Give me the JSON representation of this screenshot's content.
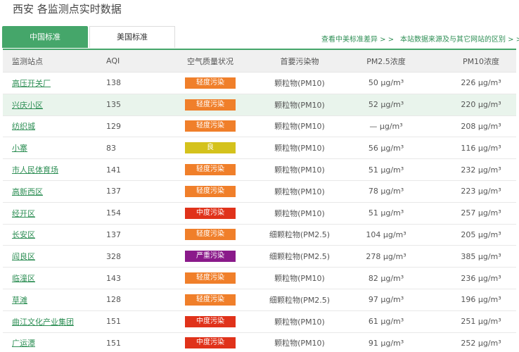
{
  "page": {
    "title": "西安 各监测点实时数据"
  },
  "tabs": [
    {
      "label": "中国标准",
      "active": true
    },
    {
      "label": "美国标准",
      "active": false
    }
  ],
  "links": {
    "standard_diff": "查看中美标准差异 > >",
    "source_diff": "本站数据来源及与其它网站的区别 > >"
  },
  "colors": {
    "accent": "#45a66a",
    "level_good": "#d4c21c",
    "level_light": "#f07f2a",
    "level_medium": "#e0321a",
    "level_severe": "#8a1a8a"
  },
  "table": {
    "headers": [
      "监测站点",
      "AQI",
      "空气质量状况",
      "首要污染物",
      "PM2.5浓度",
      "PM10浓度"
    ],
    "rows": [
      {
        "site": "高压开关厂",
        "aqi": "138",
        "level": "轻度污染",
        "level_color": "#f07f2a",
        "pollutant": "颗粒物(PM10)",
        "pm25": "50 μg/m³",
        "pm10": "226 μg/m³"
      },
      {
        "site": "兴庆小区",
        "aqi": "135",
        "level": "轻度污染",
        "level_color": "#f07f2a",
        "pollutant": "颗粒物(PM10)",
        "pm25": "52 μg/m³",
        "pm10": "220 μg/m³",
        "highlight": true
      },
      {
        "site": "纺织城",
        "aqi": "129",
        "level": "轻度污染",
        "level_color": "#f07f2a",
        "pollutant": "颗粒物(PM10)",
        "pm25": "— μg/m³",
        "pm10": "208 μg/m³"
      },
      {
        "site": "小寨",
        "aqi": "83",
        "level": "良",
        "level_color": "#d4c21c",
        "pollutant": "颗粒物(PM10)",
        "pm25": "56 μg/m³",
        "pm10": "116 μg/m³"
      },
      {
        "site": "市人民体育场",
        "aqi": "141",
        "level": "轻度污染",
        "level_color": "#f07f2a",
        "pollutant": "颗粒物(PM10)",
        "pm25": "51 μg/m³",
        "pm10": "232 μg/m³"
      },
      {
        "site": "高新西区",
        "aqi": "137",
        "level": "轻度污染",
        "level_color": "#f07f2a",
        "pollutant": "颗粒物(PM10)",
        "pm25": "78 μg/m³",
        "pm10": "223 μg/m³"
      },
      {
        "site": "经开区",
        "aqi": "154",
        "level": "中度污染",
        "level_color": "#e0321a",
        "pollutant": "颗粒物(PM10)",
        "pm25": "51 μg/m³",
        "pm10": "257 μg/m³"
      },
      {
        "site": "长安区",
        "aqi": "137",
        "level": "轻度污染",
        "level_color": "#f07f2a",
        "pollutant": "细颗粒物(PM2.5)",
        "pm25": "104 μg/m³",
        "pm10": "205 μg/m³"
      },
      {
        "site": "阎良区",
        "aqi": "328",
        "level": "严重污染",
        "level_color": "#8a1a8a",
        "pollutant": "细颗粒物(PM2.5)",
        "pm25": "278 μg/m³",
        "pm10": "385 μg/m³"
      },
      {
        "site": "临潼区",
        "aqi": "143",
        "level": "轻度污染",
        "level_color": "#f07f2a",
        "pollutant": "颗粒物(PM10)",
        "pm25": "82 μg/m³",
        "pm10": "236 μg/m³"
      },
      {
        "site": "草滩",
        "aqi": "128",
        "level": "轻度污染",
        "level_color": "#f07f2a",
        "pollutant": "细颗粒物(PM2.5)",
        "pm25": "97 μg/m³",
        "pm10": "196 μg/m³"
      },
      {
        "site": "曲江文化产业集团",
        "aqi": "151",
        "level": "中度污染",
        "level_color": "#e0321a",
        "pollutant": "颗粒物(PM10)",
        "pm25": "61 μg/m³",
        "pm10": "251 μg/m³"
      },
      {
        "site": "广运潭",
        "aqi": "151",
        "level": "中度污染",
        "level_color": "#e0321a",
        "pollutant": "颗粒物(PM10)",
        "pm25": "91 μg/m³",
        "pm10": "252 μg/m³"
      }
    ]
  }
}
